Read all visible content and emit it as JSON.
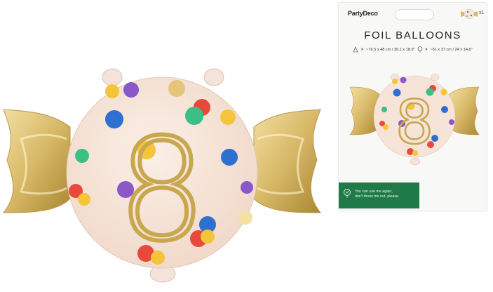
{
  "package": {
    "brand": "PartyDeco",
    "count": "x1",
    "title": "FOIL BALLOONS",
    "dimensions_inflated": "~76.5 x 48 cm / 30.1 x 18.9\"",
    "dimensions_flat": "~61 x 37 cm / 24 x 14.6\"",
    "eco_line1": "You can use me again,",
    "eco_line2": "don't throw me out, please."
  },
  "balloon": {
    "number": "8",
    "colors": {
      "body": "#f8e7dc",
      "gold": "#d6b868",
      "gold_dark": "#b08f43",
      "confetti": [
        "#f4c43a",
        "#2e6fd0",
        "#8a58c8",
        "#3bbf84",
        "#e8493a"
      ]
    }
  }
}
